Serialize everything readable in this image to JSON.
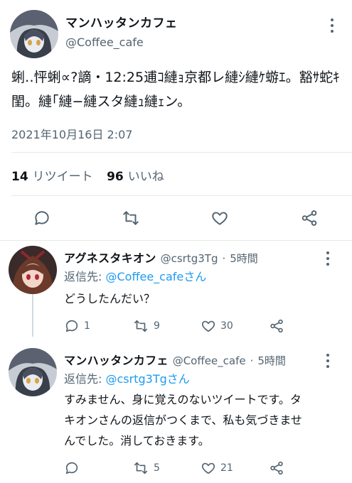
{
  "main_tweet": {
    "author_name": "マンハッタンカフェ",
    "author_handle": "@Coffee_cafe",
    "text": "蜊‥怦蜊∝?謫・12:25逋ｺ縺ｮ京都レ縺ｼ縺ｹ蝣ｴ。豁ｻ蛇ｷ閨。縺｢縺−縺スタ縺ｭ縺ｪン。",
    "timestamp": "2021年10月16日 2:07",
    "retweet_count": "14",
    "retweet_label": "リツイート",
    "like_count": "96",
    "like_label": "いいね"
  },
  "replies": [
    {
      "author_name": "アグネスタキオン",
      "author_handle": "@csrtg3Tg",
      "time": "5時間",
      "reply_to_label": "返信先:",
      "reply_to_mention": "@Coffee_cafeさん",
      "text": "どうしたんだい？",
      "reply_count": "1",
      "retweet_count": "9",
      "like_count": "30"
    },
    {
      "author_name": "マンハッタンカフェ",
      "author_handle": "@Coffee_cafe",
      "time": "5時間",
      "reply_to_label": "返信先:",
      "reply_to_mention": "@csrtg3Tgさん",
      "text_lines": [
        "すみません、身に覚えのないツイートです。タ",
        "キオンさんの返信がつくまで、私も気づきませ",
        "んでした。消しておきます。"
      ],
      "reply_count": "",
      "retweet_count": "5",
      "like_count": "21"
    }
  ],
  "meta_separator": "·",
  "colors": {
    "text": "#0f1419",
    "secondary": "#536471",
    "link": "#1d9bf0",
    "divider": "#e7e9ea"
  },
  "icons": [
    "reply-icon",
    "retweet-icon",
    "like-icon",
    "share-icon",
    "more-icon"
  ]
}
